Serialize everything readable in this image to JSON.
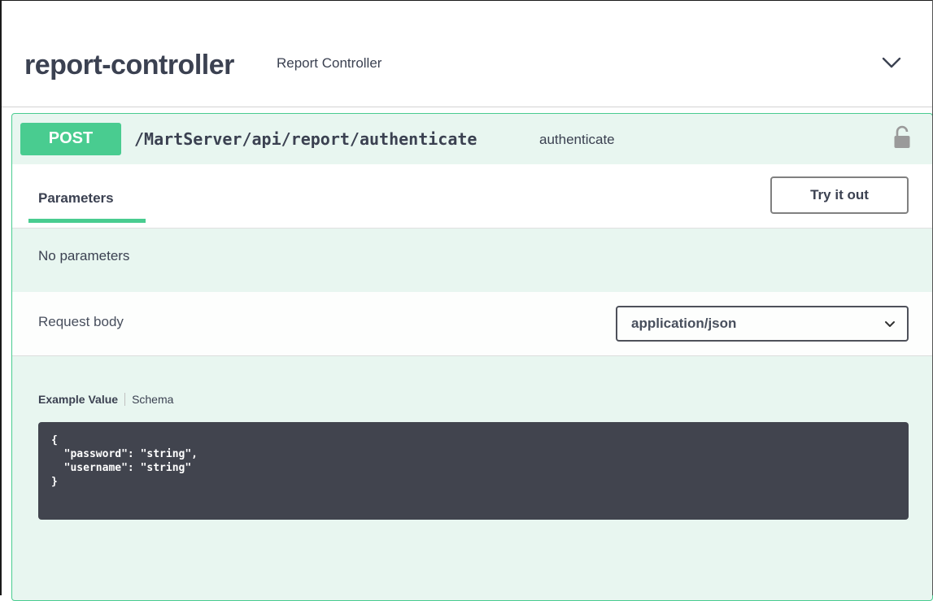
{
  "controller": {
    "name": "report-controller",
    "description": "Report Controller"
  },
  "operation": {
    "method": "POST",
    "path": "/MartServer/api/report/authenticate",
    "summary": "authenticate",
    "method_color": "#49cc90"
  },
  "parameters": {
    "tab_label": "Parameters",
    "try_button_label": "Try it out",
    "no_params_text": "No parameters"
  },
  "request_body": {
    "label": "Request body",
    "content_type": "application/json"
  },
  "example": {
    "tab_example": "Example Value",
    "tab_schema": "Schema",
    "code_lines": [
      "{",
      "  \"password\": \"string\",",
      "  \"username\": \"string\"",
      "}"
    ]
  },
  "icons": {
    "collapse": "chevron-down-icon",
    "lock": "lock-icon",
    "select": "chevron-down-icon"
  }
}
